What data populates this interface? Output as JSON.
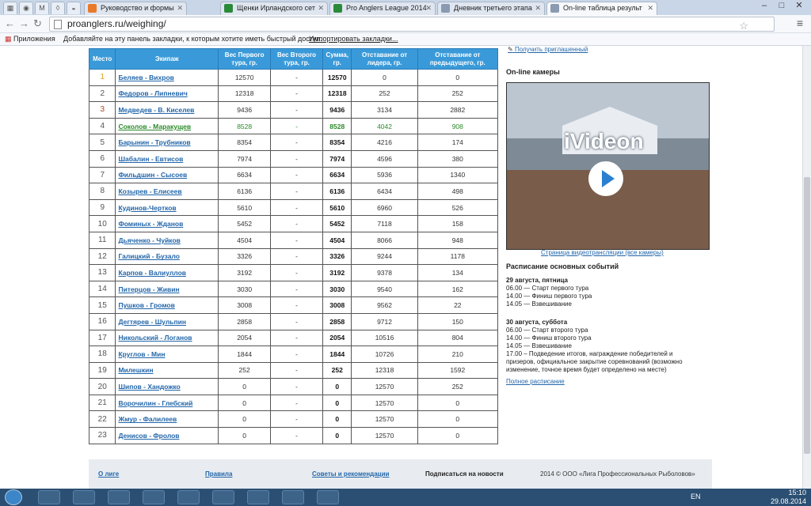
{
  "browser": {
    "tabs": [
      {
        "label": "Руководство и формы",
        "color": "#e87a2a"
      },
      {
        "label": "Щенки Ирландского сет",
        "color": "#2a8a3a"
      },
      {
        "label": "Pro Anglers League 2014",
        "color": "#2a8a3a"
      },
      {
        "label": "Дневник третьего этапа",
        "color": "#8a9ab0"
      },
      {
        "label": "On-line таблица результ",
        "color": "#8a9ab0"
      }
    ],
    "url": "proanglers.ru/weighing/",
    "bookmarks_apps": "Приложения",
    "bookmarks_msg": "Добавляйте на эту панель закладки, к которым хотите иметь быстрый доступ.",
    "bookmarks_import": "Импортировать закладки..."
  },
  "table": {
    "headers": [
      "Место",
      "Экипаж",
      "Вес Первого тура, гр.",
      "Вес Второго тура, гр.",
      "Сумма, гр.",
      "Отставание от лидера, гр.",
      "Отставание от предыдущего, гр."
    ],
    "rows": [
      {
        "place": "1",
        "team": "Беляев - Вихров",
        "w1": "12570",
        "w2": "-",
        "sum": "12570",
        "lead": "0",
        "prev": "0",
        "placeColor": "#e0a020"
      },
      {
        "place": "2",
        "team": "Федоров - Липневич",
        "w1": "12318",
        "w2": "-",
        "sum": "12318",
        "lead": "252",
        "prev": "252",
        "placeColor": "#555555"
      },
      {
        "place": "3",
        "team": "Медведев - В. Киселев",
        "w1": "9436",
        "w2": "-",
        "sum": "9436",
        "lead": "3134",
        "prev": "2882",
        "placeColor": "#b04020"
      },
      {
        "place": "4",
        "team": "Соколов - Маракущев",
        "w1": "8528",
        "w2": "-",
        "sum": "8528",
        "lead": "4042",
        "prev": "908",
        "placeColor": "#555555",
        "green": true
      },
      {
        "place": "5",
        "team": "Барынин - Трубников",
        "w1": "8354",
        "w2": "-",
        "sum": "8354",
        "lead": "4216",
        "prev": "174"
      },
      {
        "place": "6",
        "team": "Шабалин - Евтисов",
        "w1": "7974",
        "w2": "-",
        "sum": "7974",
        "lead": "4596",
        "prev": "380"
      },
      {
        "place": "7",
        "team": "Фильдшин - Сысоев",
        "w1": "6634",
        "w2": "-",
        "sum": "6634",
        "lead": "5936",
        "prev": "1340"
      },
      {
        "place": "8",
        "team": "Козырев - Елисеев",
        "w1": "6136",
        "w2": "-",
        "sum": "6136",
        "lead": "6434",
        "prev": "498"
      },
      {
        "place": "9",
        "team": "Кудинов-Чертков",
        "w1": "5610",
        "w2": "-",
        "sum": "5610",
        "lead": "6960",
        "prev": "526"
      },
      {
        "place": "10",
        "team": "Фоминых - Жданов",
        "w1": "5452",
        "w2": "-",
        "sum": "5452",
        "lead": "7118",
        "prev": "158"
      },
      {
        "place": "11",
        "team": "Дьяченко - Чуйков",
        "w1": "4504",
        "w2": "-",
        "sum": "4504",
        "lead": "8066",
        "prev": "948"
      },
      {
        "place": "12",
        "team": "Галицкий - Бузало",
        "w1": "3326",
        "w2": "-",
        "sum": "3326",
        "lead": "9244",
        "prev": "1178"
      },
      {
        "place": "13",
        "team": "Карпов - Валиуллов",
        "w1": "3192",
        "w2": "-",
        "sum": "3192",
        "lead": "9378",
        "prev": "134"
      },
      {
        "place": "14",
        "team": "Питерцов - Живин",
        "w1": "3030",
        "w2": "-",
        "sum": "3030",
        "lead": "9540",
        "prev": "162"
      },
      {
        "place": "15",
        "team": "Пушков - Громов",
        "w1": "3008",
        "w2": "-",
        "sum": "3008",
        "lead": "9562",
        "prev": "22"
      },
      {
        "place": "16",
        "team": "Дегтярев - Шульпин",
        "w1": "2858",
        "w2": "-",
        "sum": "2858",
        "lead": "9712",
        "prev": "150"
      },
      {
        "place": "17",
        "team": "Никольский - Логанов",
        "w1": "2054",
        "w2": "-",
        "sum": "2054",
        "lead": "10516",
        "prev": "804"
      },
      {
        "place": "18",
        "team": "Круглов - Мин",
        "w1": "1844",
        "w2": "-",
        "sum": "1844",
        "lead": "10726",
        "prev": "210"
      },
      {
        "place": "19",
        "team": "Милешкин",
        "w1": "252",
        "w2": "-",
        "sum": "252",
        "lead": "12318",
        "prev": "1592"
      },
      {
        "place": "20",
        "team": "Шипов - Хандожко",
        "w1": "0",
        "w2": "-",
        "sum": "0",
        "lead": "12570",
        "prev": "252"
      },
      {
        "place": "21",
        "team": "Ворочилин - Глебский",
        "w1": "0",
        "w2": "-",
        "sum": "0",
        "lead": "12570",
        "prev": "0"
      },
      {
        "place": "22",
        "team": "Жмур - Фалилеев",
        "w1": "0",
        "w2": "-",
        "sum": "0",
        "lead": "12570",
        "prev": "0"
      },
      {
        "place": "23",
        "team": "Денисов - Фролов",
        "w1": "0",
        "w2": "-",
        "sum": "0",
        "lead": "12570",
        "prev": "0"
      }
    ]
  },
  "sidebar": {
    "top_link": "Получить приглашенный",
    "cam_title": "On-line камеры",
    "cam_brand": "iVideon",
    "cam_link": "Страница видеотрансляции (все камеры)",
    "sched_title": "Расписание основных событий",
    "day1": "29 августа, пятница",
    "day1_items": [
      "06.00 — Старт первого тура",
      "14.00 — Финиш первого тура",
      "14.05 — Взвешивание"
    ],
    "day2": "30 августа, суббота",
    "day2_items": [
      "06.00 — Старт второго тура",
      "14.00 — Финиш второго тура",
      "14.05 — Взвешивание",
      "17.00 – Подведение итогов, награждение победителей и",
      "призеров, официальное закрытие соревнований (возможно",
      "изменение, точное время будет определено на месте)"
    ],
    "full_link": "Полное расписание"
  },
  "footer": {
    "about": "О лиге",
    "rules": "Правила",
    "tips": "Советы и рекомендации",
    "subscribe": "Подписаться на новости",
    "copyright": "2014 © ООО «Лига Профессиональных Рыболовов»"
  },
  "taskbar": {
    "lang": "EN",
    "time": "15:10",
    "date": "29.08.2014"
  }
}
